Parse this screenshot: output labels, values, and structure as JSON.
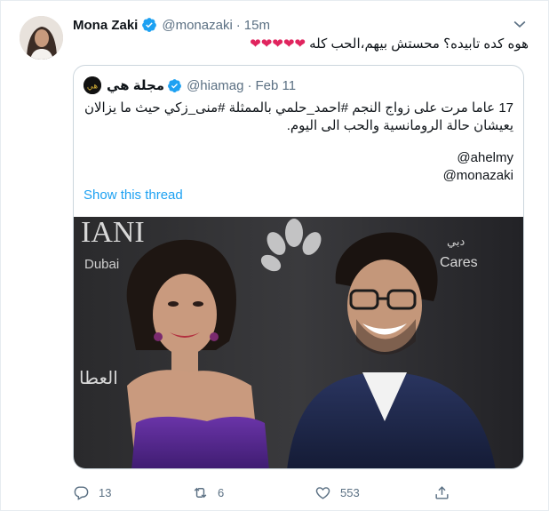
{
  "tweet": {
    "author_name": "Mona Zaki",
    "author_handle": "@monazaki",
    "separator": "·",
    "time": "15m",
    "text": "هوه كده تابيده؟ محستش بيهم،الحب كله",
    "hearts": "❤❤❤❤❤"
  },
  "quote": {
    "author_name": "مجلة هي",
    "author_handle": "@hiamag",
    "separator": "·",
    "time": "Feb 11",
    "text": "17 عاما مرت على زواج النجم #احمد_حلمي بالممثلة #منى_زكي حيث ما يزالان يعيشان حالة الرومانسية والحب الى اليوم.",
    "mentions": [
      "@ahelmy",
      "@monazaki"
    ],
    "show_thread": "Show this thread",
    "logo_letter": "هي"
  },
  "photo": {
    "backdrop_text_1": "IANI",
    "backdrop_text_2": "Dubai",
    "backdrop_text_3": "دبي",
    "backdrop_text_4": "Cares",
    "backdrop_text_5": "العطا"
  },
  "actions": {
    "reply_count": "13",
    "retweet_count": "6",
    "like_count": "553"
  },
  "colors": {
    "accent": "#1da1f2",
    "heart": "#e0245e",
    "muted": "#5b7083",
    "border": "#ccd6dd"
  },
  "icons": [
    "verified-badge-icon",
    "chevron-down-icon",
    "reply-icon",
    "retweet-icon",
    "like-icon",
    "share-icon"
  ]
}
